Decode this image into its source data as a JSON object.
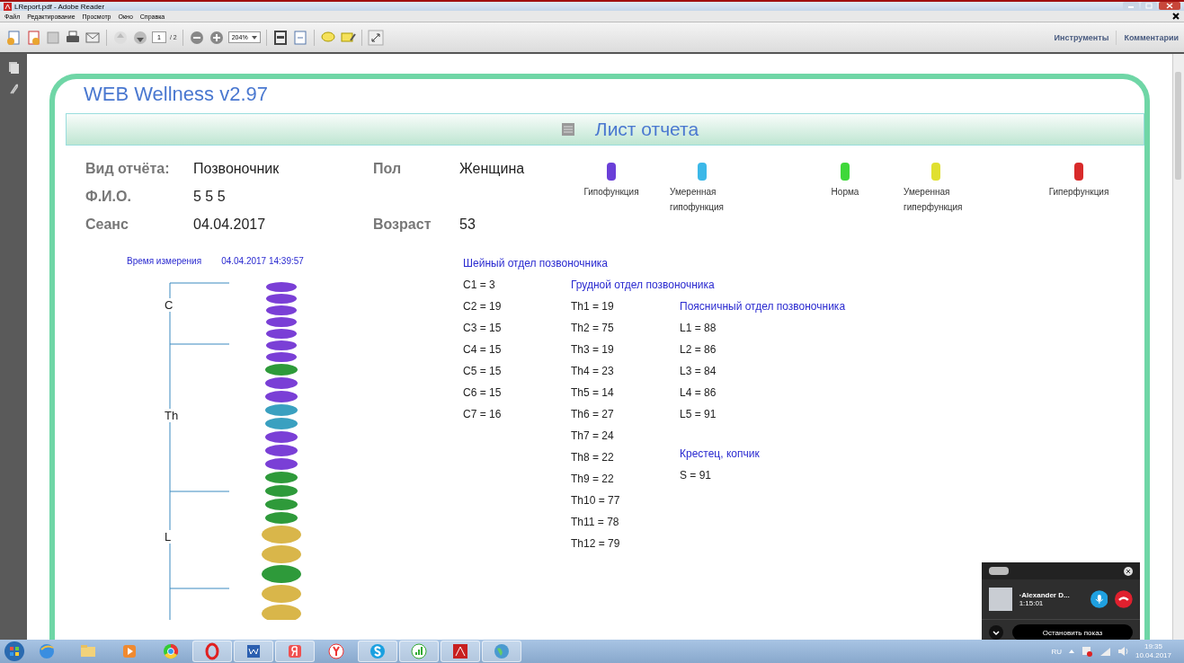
{
  "window": {
    "title": "LReport.pdf - Adobe Reader"
  },
  "menu": [
    "Файл",
    "Редактирование",
    "Просмотр",
    "Окно",
    "Справка"
  ],
  "toolbar": {
    "page": "1",
    "page_total": "/ 2",
    "zoom": "204%",
    "links": [
      "Инструменты",
      "Комментарии"
    ]
  },
  "report": {
    "app_title": "WEB Wellness  v2.97",
    "sheet_title": "Лист отчета",
    "fields": [
      {
        "label": "Вид отчёта:",
        "value": "Позвоночник"
      },
      {
        "label": "Пол",
        "value": "Женщина"
      },
      {
        "label": "Ф.И.О.",
        "value": "5  5  5"
      },
      {
        "label": "Сеанс",
        "value": "04.04.2017"
      },
      {
        "label": "Возраст",
        "value": "53"
      }
    ],
    "legend": [
      {
        "label": "Гипофункция",
        "color": "#6a3fd8"
      },
      {
        "label": "Умеренная гипофункция",
        "color": "#3cb8e8"
      },
      {
        "label": "Норма",
        "color": "#3fd83a"
      },
      {
        "label": "Умеренная гиперфункция",
        "color": "#e0e030"
      },
      {
        "label": "Гиперфункция",
        "color": "#d82a2a"
      }
    ],
    "measure_label": "Время измерения",
    "measure_time": "04.04.2017  14:39:57",
    "spine_labels": [
      "C",
      "Th",
      "L"
    ],
    "columns": [
      [
        {
          "title": "Шейный отдел позвоночника",
          "items": [
            "C1 = 3",
            "C2 = 19",
            "C3 = 15",
            "C4 = 15",
            "C5 = 15",
            "C6 = 15",
            "C7 = 16"
          ]
        }
      ],
      [
        {
          "title": "Грудной отдел позвоночника",
          "items": [
            "Th1 = 19",
            "Th2 = 75",
            "Th3 = 19",
            "Th4 = 23",
            "Th5 = 14",
            "Th6 = 27",
            "Th7 = 24",
            "Th8 = 22",
            "Th9 = 22",
            "Th10 = 77",
            "Th11 = 78",
            "Th12 = 79"
          ]
        }
      ],
      [
        {
          "title": "Поясничный отдел позвоночника",
          "items": [
            "L1 = 88",
            "L2 = 86",
            "L3 = 84",
            "L4 = 86",
            "L5 = 91"
          ]
        },
        {
          "title": "Крестец, копчик",
          "items": [
            "S = 91"
          ]
        }
      ]
    ]
  },
  "call": {
    "name": "·Alexander D...",
    "duration": "1:15:01",
    "button": "Остановить показ"
  },
  "tray": {
    "lang": "RU",
    "time": "19:35",
    "date": "10.04.2017"
  }
}
